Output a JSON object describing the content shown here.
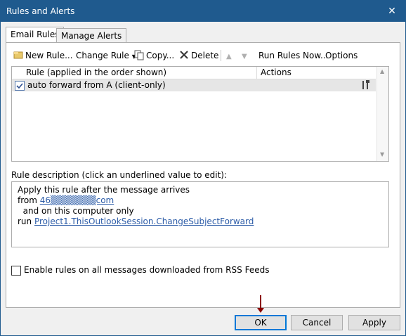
{
  "window": {
    "title": "Rules and Alerts",
    "close_symbol": "✕"
  },
  "tabs": [
    {
      "label": "Email Rules",
      "active": true
    },
    {
      "label": "Manage Alerts",
      "active": false
    }
  ],
  "toolbar": {
    "new_rule": "New Rule...",
    "change_rule": "Change Rule",
    "copy": "Copy...",
    "delete": "Delete",
    "run_rules_now": "Run Rules Now...",
    "options": "Options"
  },
  "rules_list": {
    "col_rule": "Rule (applied in the order shown)",
    "col_actions": "Actions",
    "rows": [
      {
        "name": "auto forward from A  (client-only)",
        "checked": true
      }
    ]
  },
  "description": {
    "label": "Rule description (click an underlined value to edit):",
    "line1": "Apply this rule after the message arrives",
    "line2_prefix": "from ",
    "line2_link": "46▒▒▒▒▒▒▒com",
    "line3": "  and on this computer only",
    "line4_prefix": "run ",
    "line4_link": "Project1.ThisOutlookSession.ChangeSubjectForward"
  },
  "rss_checkbox": {
    "label": "Enable rules on all messages downloaded from RSS Feeds",
    "checked": false
  },
  "buttons": {
    "ok": "OK",
    "cancel": "Cancel",
    "apply": "Apply"
  },
  "colors": {
    "title_bar": "#1f5a8e",
    "link": "#2b5ba7",
    "arrow": "#8b0000"
  }
}
